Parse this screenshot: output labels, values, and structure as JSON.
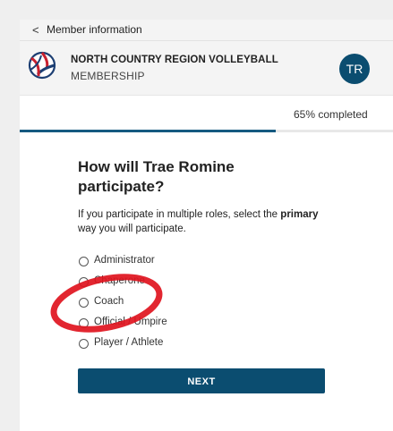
{
  "topbar": {
    "back_label": "Member information",
    "back_glyph": "<"
  },
  "header": {
    "org_name": "NORTH COUNTRY REGION VOLLEYBALL",
    "subtitle": "MEMBERSHIP",
    "avatar_initials": "TR",
    "avatar_color": "#0b4d70"
  },
  "progress": {
    "percent": 65,
    "label": "65% completed",
    "color": "#155a80"
  },
  "question": {
    "heading": "How will Trae Romine participate?",
    "help_prefix": "If you participate in multiple roles, select the",
    "help_bold": "primary",
    "help_suffix": "way you will participate."
  },
  "options": [
    {
      "label": "Administrator",
      "selected": false
    },
    {
      "label": "Chaperone",
      "selected": false
    },
    {
      "label": "Coach",
      "selected": false
    },
    {
      "label": "Official / Umpire",
      "selected": false
    },
    {
      "label": "Player / Athlete",
      "selected": false
    }
  ],
  "next_button": {
    "label": "NEXT",
    "color": "#0b4d70"
  },
  "annotation": {
    "type": "red-ellipse",
    "color": "#e0141e",
    "target": "Coach"
  }
}
